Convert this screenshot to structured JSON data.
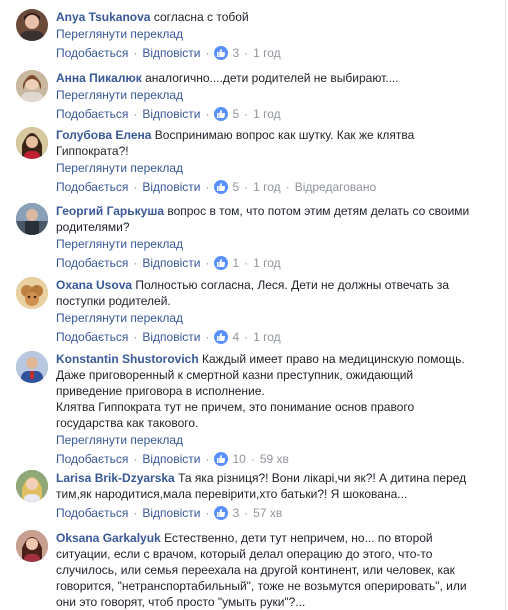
{
  "ui": {
    "like": "Подобається",
    "reply": "Відповісти",
    "translate": "Переглянути переклад",
    "sep": "·"
  },
  "comments": [
    {
      "author": "Anya Tsukanova",
      "lines": [
        "согласна с тобой"
      ],
      "likes": "3",
      "time": "1 год",
      "edited": ""
    },
    {
      "author": "Анна Пикалюк",
      "lines": [
        "аналогично....дети родителей не выбирают...."
      ],
      "likes": "5",
      "time": "1 год",
      "edited": ""
    },
    {
      "author": "Голубова Елена",
      "lines": [
        "Воспринимаю вопрос как шутку. Как же клятва",
        "Гиппократа?!"
      ],
      "likes": "5",
      "time": "1 год",
      "edited": "Відредаговано"
    },
    {
      "author": "Георгий Гарькуша",
      "lines": [
        "вопрос в том, что потом этим детям делать со своими",
        "родителями?"
      ],
      "likes": "1",
      "time": "1 год",
      "edited": ""
    },
    {
      "author": "Oxana Usova",
      "lines": [
        "Полностью согласна, Леся. Дети не должны отвечать за",
        "поступки родителей."
      ],
      "likes": "4",
      "time": "1 год",
      "edited": ""
    },
    {
      "author": "Konstantin Shustorovich",
      "lines": [
        "Каждый имеет право на медицинскую помощь.",
        "Даже приговоренный к смертной казни преступник, ожидающий",
        "приведение приговора в исполнение.",
        "Клятва Гиппократа тут не причем, это понимание основ правого",
        "государства как такового."
      ],
      "likes": "10",
      "time": "59 хв",
      "edited": ""
    },
    {
      "author": "Larisa Brik-Dzyarska",
      "lines": [
        "Та яка різниця?! Вони лікарі,чи як?! А дитина перед",
        "тим,як народитися,мала перевірити,хто батьки?! Я шокована..."
      ],
      "likes": "3",
      "time": "57 хв",
      "edited": ""
    },
    {
      "author": "Oksana Garkalyuk",
      "lines": [
        "Естественно, дети тут непричем, но... по второй",
        "ситуации, если с врачом, который делал операцию до этого, что-то",
        "случилось, или семья переехала на другой континент, или человек, как",
        "говорится, \"нетранспортабильный\", тоже не возьмутся оперировать\", или",
        "они это говорят, чтоб просто \"умыть руки\"?..."
      ],
      "likes": "",
      "time": "",
      "edited": ""
    }
  ],
  "avatar_colors": [
    "#6b4a3a",
    "#8a6a55",
    "#7a5a3a",
    "#4a5a6a",
    "#c8a060",
    "#5a6a8a",
    "#4a6a3a",
    "#8a4a4a"
  ],
  "accent": "#385898",
  "like_color": "#5890ff"
}
